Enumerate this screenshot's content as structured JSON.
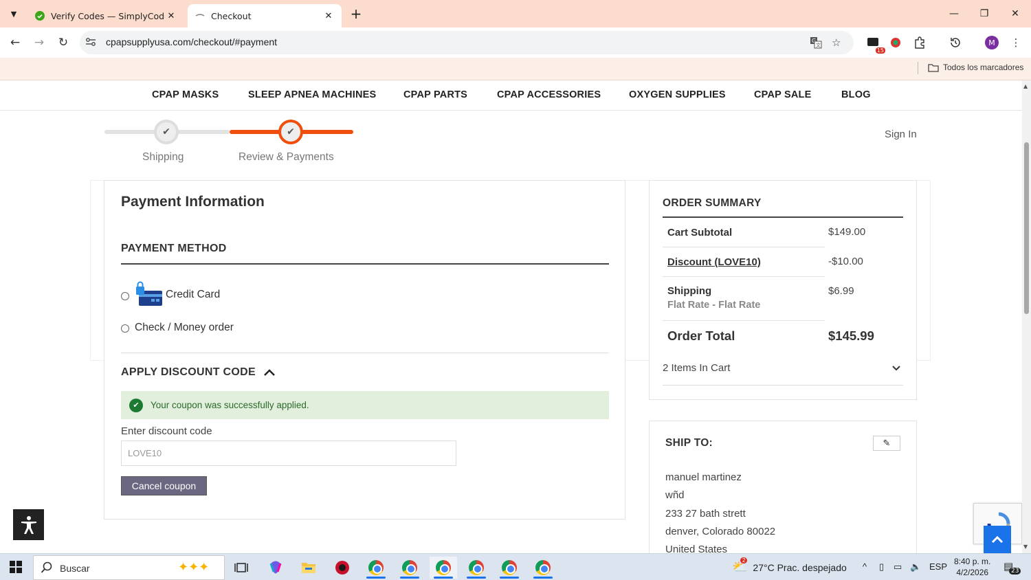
{
  "browser": {
    "tabs": [
      {
        "title": "Verify Codes — SimplyCodes",
        "active": false
      },
      {
        "title": "Checkout",
        "active": true
      }
    ],
    "url": "cpapsupplyusa.com/checkout/#payment",
    "extension_badge": "15",
    "profile_initial": "M",
    "bookmarks_all": "Todos los marcadores"
  },
  "nav": {
    "items": [
      "CPAP MASKS",
      "SLEEP APNEA MACHINES",
      "CPAP PARTS",
      "CPAP ACCESSORIES",
      "OXYGEN SUPPLIES",
      "CPAP SALE",
      "BLOG"
    ]
  },
  "progress": {
    "steps": [
      {
        "label": "Shipping",
        "state": "complete"
      },
      {
        "label": "Review & Payments",
        "state": "current"
      }
    ]
  },
  "sign_in": "Sign In",
  "payment": {
    "title": "Payment Information",
    "method_title": "PAYMENT METHOD",
    "methods": [
      {
        "label": "Credit Card",
        "icon": "credit-card-lock-icon"
      },
      {
        "label": "Check / Money order"
      }
    ],
    "discount": {
      "title": "APPLY DISCOUNT CODE",
      "success_message": "Your coupon was successfully applied.",
      "code_label": "Enter discount code",
      "code_value": "LOVE10",
      "cancel_label": "Cancel coupon"
    }
  },
  "summary": {
    "title": "ORDER SUMMARY",
    "cart_subtotal_label": "Cart Subtotal",
    "cart_subtotal_value": "$149.00",
    "discount_label": "Discount (LOVE10)",
    "discount_value": "-$10.00",
    "shipping_label": "Shipping",
    "shipping_method": "Flat Rate - Flat Rate",
    "shipping_value": "$6.99",
    "total_label": "Order Total",
    "total_value": "$145.99",
    "items_in_cart": "2 Items In Cart"
  },
  "ship_to": {
    "title": "SHIP TO:",
    "lines": [
      "manuel martinez",
      "wñd",
      "233 27 bath strett",
      "denver, Colorado 80022",
      "United States"
    ]
  },
  "taskbar": {
    "search_label": "Buscar",
    "weather": "27°C  Prac. despejado",
    "weather_badge": "2",
    "language": "ESP",
    "time": "8:40 p. m.",
    "date": "4/2/2026",
    "notifications": "23"
  },
  "colors": {
    "accent_orange": "#f04e0d",
    "tabbar_bg": "#fbdccd",
    "cancel_button": "#6b6781",
    "success_bg": "#e2efdc"
  }
}
